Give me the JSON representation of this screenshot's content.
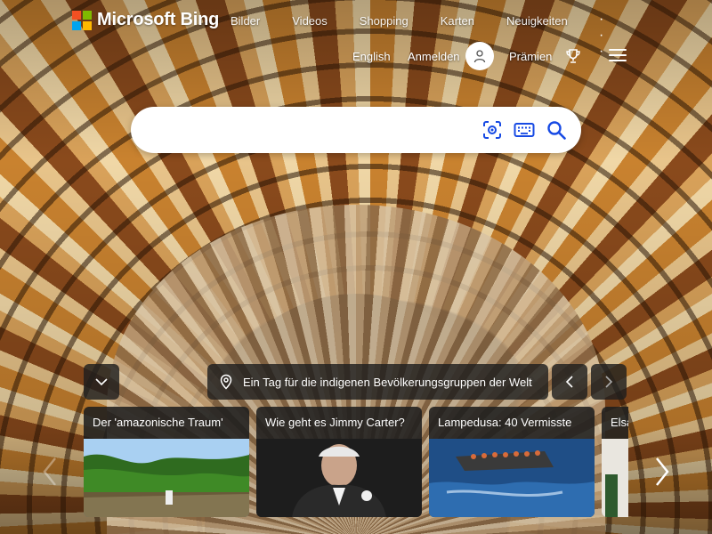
{
  "brand": {
    "name": "Microsoft Bing",
    "logo_colors": [
      "#f25022",
      "#7fba00",
      "#00a4ef",
      "#ffb900"
    ]
  },
  "nav": {
    "items": [
      "Bilder",
      "Videos",
      "Shopping",
      "Karten",
      "Neuigkeiten"
    ],
    "more": "· · ·"
  },
  "account": {
    "language": "English",
    "signin": "Anmelden",
    "rewards": "Prämien"
  },
  "search": {
    "value": "",
    "placeholder": ""
  },
  "icons": {
    "visual_search": "camera-scan-icon",
    "keyboard": "keyboard-icon",
    "search": "search-icon",
    "profile": "person-icon",
    "rewards": "trophy-icon",
    "menu": "hamburger-icon",
    "collapse": "chevron-down-icon",
    "location": "location-pin-icon",
    "prev": "chevron-left-icon",
    "next": "chevron-right-icon"
  },
  "image_info": {
    "caption": "Ein Tag für die indigenen Bevölkerungsgruppen der Welt"
  },
  "news_cards": [
    {
      "title": "Der 'amazonische Traum'"
    },
    {
      "title": "Wie geht es Jimmy Carter?"
    },
    {
      "title": "Lampedusa: 40 Vermisste"
    },
    {
      "title": "Elsa"
    }
  ],
  "colors": {
    "accent_blue": "#174ae4",
    "panel_bg": "#1e1e1e",
    "search_bg": "#ffffff"
  }
}
